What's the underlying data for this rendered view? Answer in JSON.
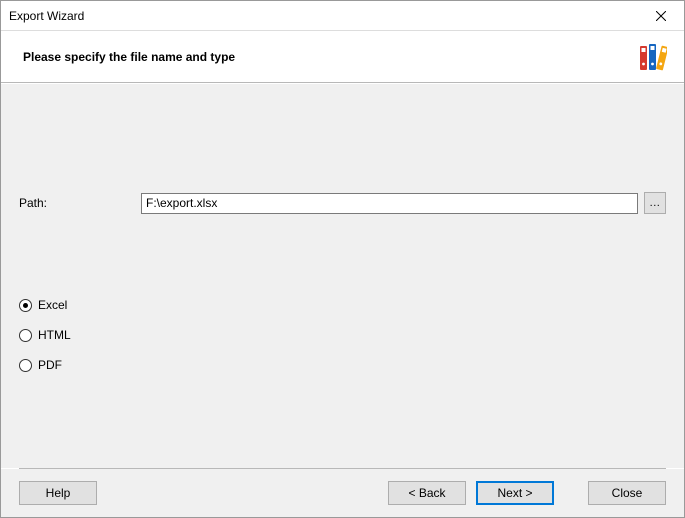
{
  "window": {
    "title": "Export Wizard"
  },
  "header": {
    "instruction": "Please specify the file name and type"
  },
  "path": {
    "label": "Path:",
    "value": "F:\\export.xlsx",
    "browse_label": "..."
  },
  "formats": {
    "selected": "excel",
    "options": [
      {
        "id": "excel",
        "label": "Excel"
      },
      {
        "id": "html",
        "label": "HTML"
      },
      {
        "id": "pdf",
        "label": "PDF"
      }
    ]
  },
  "footer": {
    "help": "Help",
    "back": "< Back",
    "next": "Next >",
    "close": "Close"
  }
}
